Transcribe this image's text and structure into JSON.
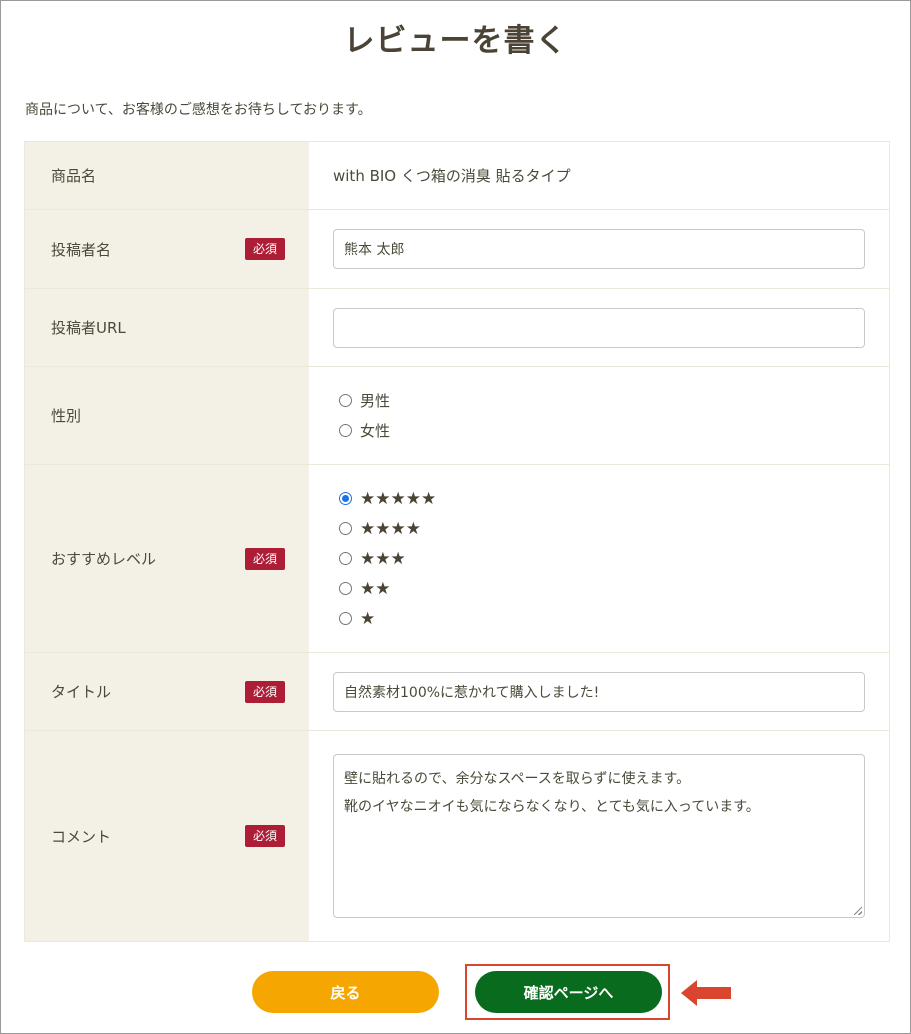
{
  "page": {
    "title": "レビューを書く",
    "intro": "商品について、お客様のご感想をお待ちしております。"
  },
  "required_badge": "必須",
  "form": {
    "product": {
      "label": "商品名",
      "value": "with BIO くつ箱の消臭 貼るタイプ"
    },
    "poster_name": {
      "label": "投稿者名",
      "value": "熊本 太郎"
    },
    "poster_url": {
      "label": "投稿者URL",
      "value": ""
    },
    "gender": {
      "label": "性別",
      "options": [
        "男性",
        "女性"
      ],
      "selected": null
    },
    "recommend": {
      "label": "おすすめレベル",
      "options": [
        "★★★★★",
        "★★★★",
        "★★★",
        "★★",
        "★"
      ],
      "selected": "★★★★★"
    },
    "title": {
      "label": "タイトル",
      "value": "自然素材100%に惹かれて購入しました!"
    },
    "comment": {
      "label": "コメント",
      "lines": [
        "壁に貼れるので、余分なスペースを取らずに使えます。",
        "靴のイヤなニオイも気にならなくなり、とても気に入っています。"
      ]
    }
  },
  "buttons": {
    "back": "戻る",
    "confirm": "確認ページへ"
  },
  "colors": {
    "label_bg": "#f3f1e5",
    "badge": "#ad1e36",
    "back_button": "#f6a600",
    "confirm_button": "#086b1d",
    "highlight": "#d9452f",
    "radio_checked": "#1a73e8"
  },
  "icons": {
    "annotation": "arrow-left-icon",
    "textarea_resize": "resize-grip-icon"
  }
}
